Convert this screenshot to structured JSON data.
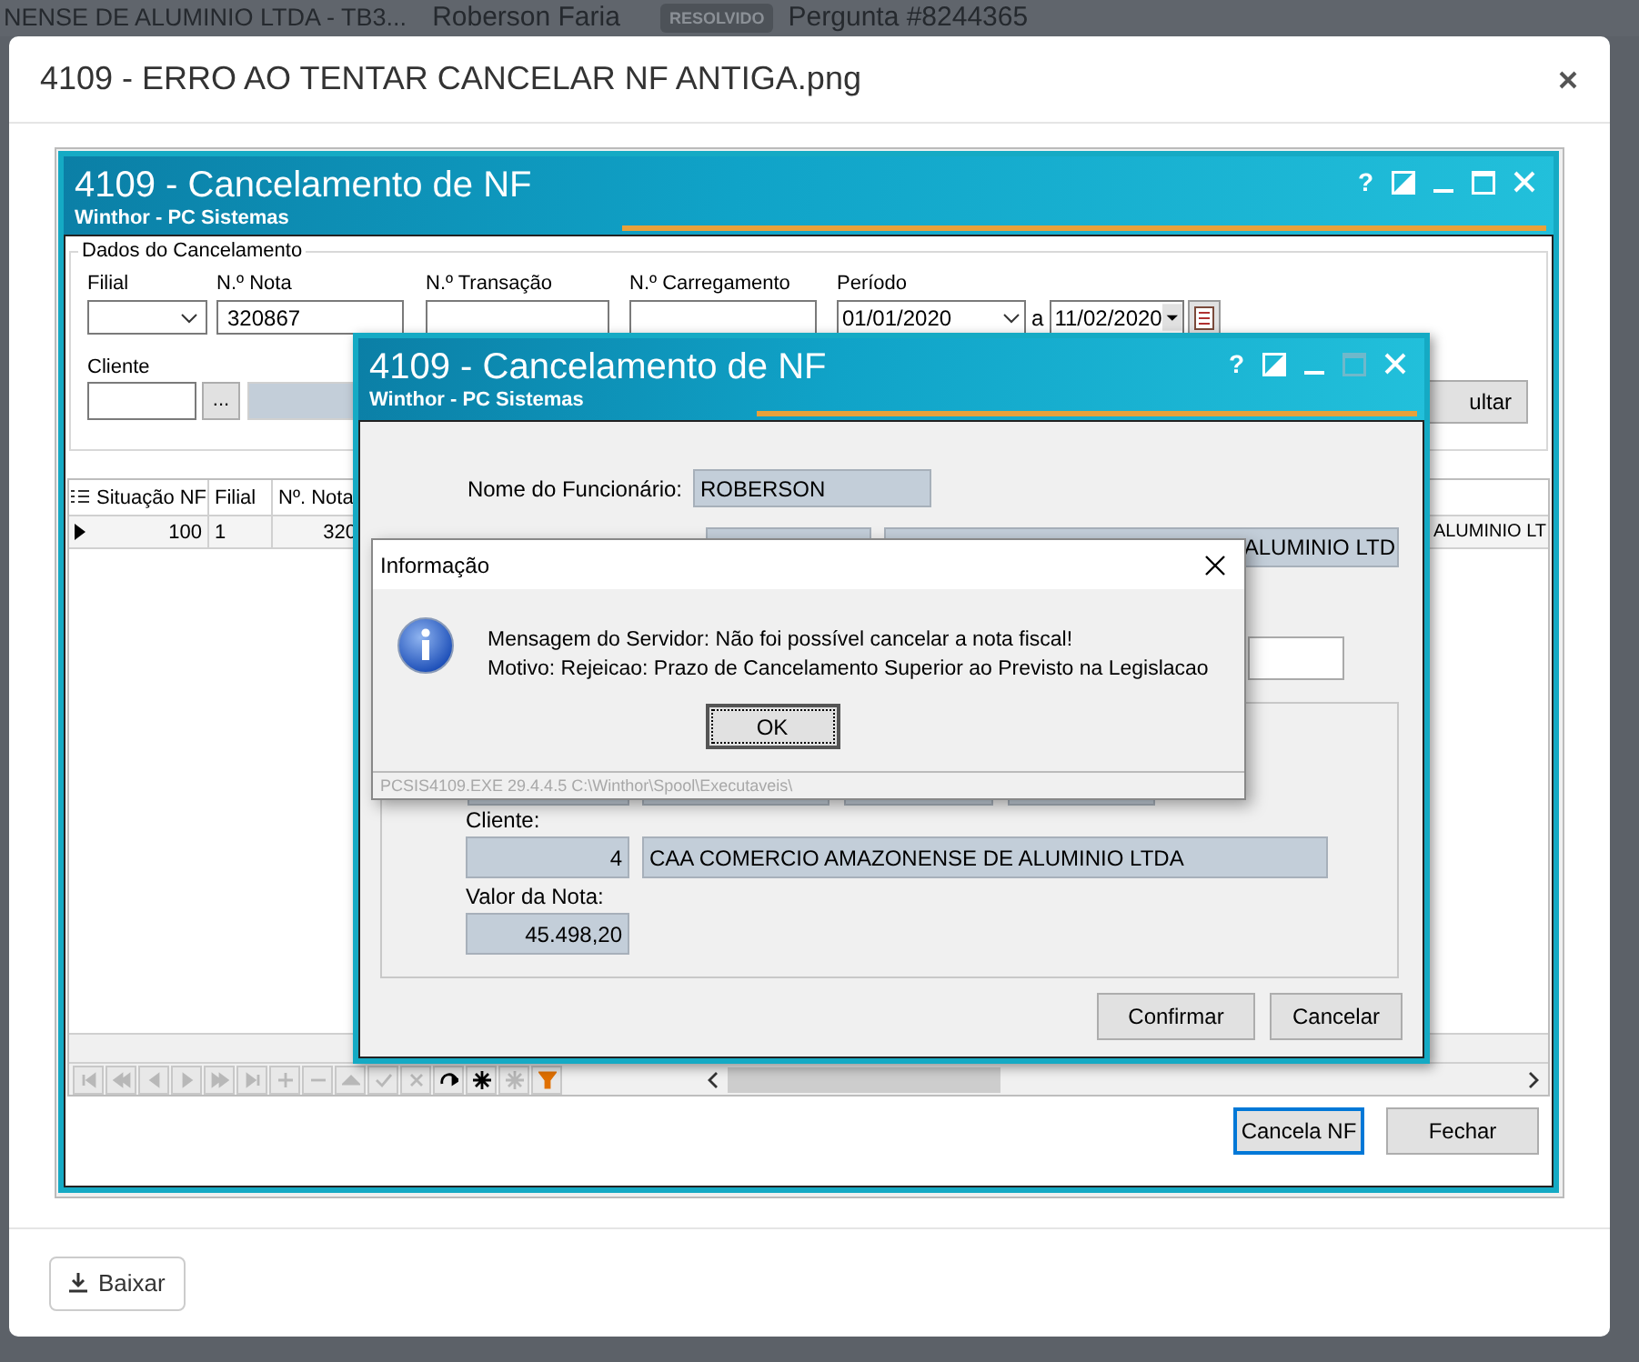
{
  "ticket_bar": {
    "customer": "NENSE DE ALUMINIO LTDA - TB3...",
    "agent": "Roberson Faria",
    "status_badge": "RESOLVIDO",
    "question": "Pergunta #8244365"
  },
  "modal": {
    "title": "4109 - ERRO AO TENTAR CANCELAR NF ANTIGA.png",
    "download_button": "Baixar"
  },
  "main_window": {
    "title": "4109 - Cancelamento de NF",
    "subtitle": "Winthor - PC Sistemas",
    "help_button": "?",
    "maximize_enabled": true,
    "group_title": "Dados do Cancelamento",
    "fields": [
      {
        "kind": "combo",
        "label": "Filial"
      },
      {
        "kind": "text",
        "label": "N.º Nota",
        "value": "320867"
      },
      {
        "kind": "text",
        "label": "N.º Transação"
      },
      {
        "kind": "text",
        "label": "N.º Carregamento"
      },
      {
        "kind": "period",
        "label": "Período",
        "from": "01/01/2020",
        "separator": "a",
        "to": "11/02/2020"
      }
    ],
    "client_label": "Cliente",
    "lookup_button": "...",
    "search_button": "ultar",
    "grid": {
      "columns": [
        "Situação NF",
        "Filial",
        "Nº. Nota"
      ],
      "rows": [
        {
          "current": true,
          "cells": [
            "100",
            "1",
            "320"
          ],
          "right_cell": "ALUMINIO LT"
        }
      ]
    },
    "navigator": [
      {
        "kind": "first",
        "enabled": false
      },
      {
        "kind": "prior_page",
        "enabled": false
      },
      {
        "kind": "prior",
        "enabled": false
      },
      {
        "kind": "next",
        "enabled": false
      },
      {
        "kind": "next_page",
        "enabled": false
      },
      {
        "kind": "last",
        "enabled": false
      },
      {
        "kind": "insert",
        "enabled": false
      },
      {
        "kind": "delete",
        "enabled": false
      },
      {
        "kind": "edit",
        "enabled": false
      },
      {
        "kind": "post",
        "enabled": false
      },
      {
        "kind": "cancel",
        "enabled": false
      },
      {
        "kind": "refresh",
        "enabled": true
      },
      {
        "kind": "asterisk",
        "enabled": true
      },
      {
        "kind": "asterisk",
        "enabled": false
      },
      {
        "kind": "filter",
        "enabled": true
      }
    ],
    "buttons": [
      {
        "label": "Cancela NF",
        "focused": true
      },
      {
        "label": "Fechar",
        "focused": false
      }
    ]
  },
  "dialog": {
    "title": "4109 - Cancelamento de NF",
    "subtitle": "Winthor - PC Sistemas",
    "help_button": "?",
    "maximize_enabled": false,
    "employee_label": "Nome do Funcionário:",
    "employee": "ROBERSON",
    "client_name_top": "ALUMINIO LTD",
    "client_label": "Cliente:",
    "client_code": "4",
    "client_name": "CAA COMERCIO AMAZONENSE DE ALUMINIO LTDA",
    "amount_label": "Valor da Nota:",
    "amount": "45.498,20",
    "buttons": [
      {
        "label": "Confirmar",
        "focused": false
      },
      {
        "label": "Cancelar",
        "focused": false
      }
    ]
  },
  "message_box": {
    "title": "Informação",
    "lines": [
      "Mensagem do Servidor: Não foi possível cancelar a nota fiscal!",
      "Motivo: Rejeicao: Prazo de Cancelamento Superior ao Previsto na Legislacao"
    ],
    "ok_button": "OK",
    "footer": "PCSIS4109.EXE 29.4.4.5 C:\\Winthor\\Spool\\Executaveis\\"
  }
}
